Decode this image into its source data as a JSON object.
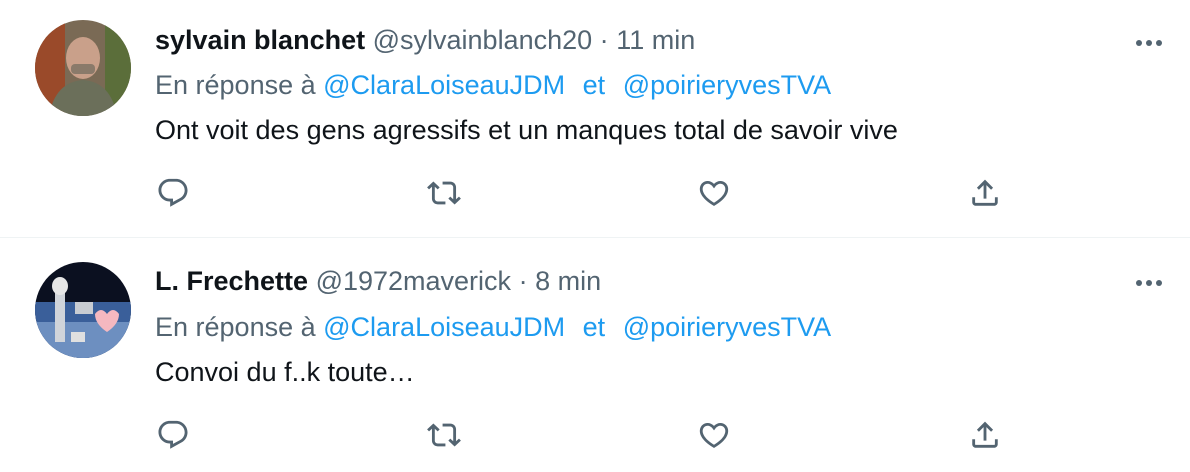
{
  "tweets": [
    {
      "name": "sylvain blanchet",
      "handle": "@sylvainblanch20",
      "separator": "·",
      "time": "11 min",
      "reply_prefix": "En réponse à",
      "mention1": "@ClaraLoiseauJDM",
      "conjunction": "et",
      "mention2": "@poirieryvesTVA",
      "text": "Ont voit des gens agressifs et un manques total de savoir vive"
    },
    {
      "name": "L. Frechette",
      "handle": "@1972maverick",
      "separator": "·",
      "time": "8 min",
      "reply_prefix": "En réponse à",
      "mention1": "@ClaraLoiseauJDM",
      "conjunction": "et",
      "mention2": "@poirieryvesTVA",
      "text": "Convoi du f..k toute…"
    }
  ],
  "icons": {
    "reply": "reply-icon",
    "retweet": "retweet-icon",
    "like": "heart-icon",
    "share": "share-icon",
    "more": "more-icon"
  },
  "colors": {
    "link": "#1d9bf0",
    "secondary": "#536471",
    "primary": "#0f1419",
    "divider": "#eff3f4"
  }
}
